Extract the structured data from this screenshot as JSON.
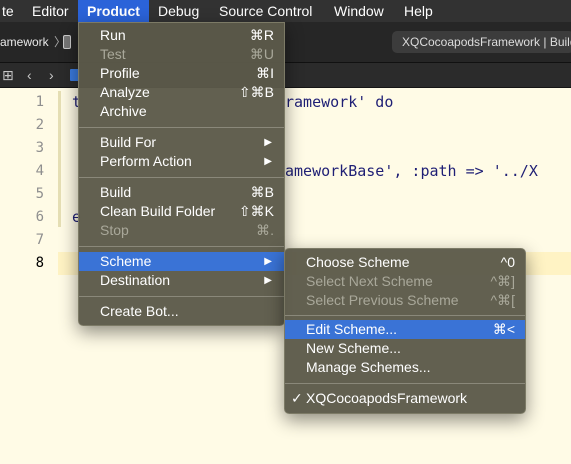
{
  "menubar": {
    "items": [
      {
        "label": "te"
      },
      {
        "label": "Editor"
      },
      {
        "label": "Product"
      },
      {
        "label": "Debug"
      },
      {
        "label": "Source Control"
      },
      {
        "label": "Window"
      },
      {
        "label": "Help"
      }
    ]
  },
  "toolbar": {
    "scheme_crumb": "amework",
    "activity_text": "XQCocoapodsFramework | Build"
  },
  "editor": {
    "line_numbers": [
      "1",
      "2",
      "3",
      "4",
      "5",
      "6",
      "7",
      "8"
    ],
    "lines": [
      {
        "text": "t",
        "tail": "ramework' do"
      },
      {
        "text": "",
        "tail": ""
      },
      {
        "text": "",
        "tail": ""
      },
      {
        "text": "",
        "tail": "ameworkBase', :path => '../X"
      },
      {
        "text": "",
        "tail": ""
      },
      {
        "text": "e",
        "tail": ""
      },
      {
        "text": "",
        "tail": ""
      },
      {
        "text": "",
        "tail": ""
      }
    ]
  },
  "product_menu": {
    "items": [
      {
        "label": "Run",
        "shortcut": "⌘R"
      },
      {
        "label": "Test",
        "shortcut": "⌘U",
        "disabled": true
      },
      {
        "label": "Profile",
        "shortcut": "⌘I"
      },
      {
        "label": "Analyze",
        "shortcut": "⇧⌘B"
      },
      {
        "label": "Archive",
        "shortcut": ""
      },
      {
        "label": "Build For",
        "submenu": "▶"
      },
      {
        "label": "Perform Action",
        "submenu": "▶"
      },
      {
        "label": "Build",
        "shortcut": "⌘B"
      },
      {
        "label": "Clean Build Folder",
        "shortcut": "⇧⌘K"
      },
      {
        "label": "Stop",
        "shortcut": "⌘.",
        "disabled": true
      },
      {
        "label": "Scheme",
        "submenu": "▶"
      },
      {
        "label": "Destination",
        "submenu": "▶"
      },
      {
        "label": "Create Bot..."
      }
    ]
  },
  "scheme_menu": {
    "items": [
      {
        "label": "Choose Scheme",
        "shortcut": "^0"
      },
      {
        "label": "Select Next Scheme",
        "shortcut": "^⌘]",
        "disabled": true
      },
      {
        "label": "Select Previous Scheme",
        "shortcut": "^⌘[",
        "disabled": true
      },
      {
        "label": "Edit Scheme...",
        "shortcut": "⌘<"
      },
      {
        "label": "New Scheme..."
      },
      {
        "label": "Manage Schemes..."
      },
      {
        "label": "XQCocoapodsFramework",
        "check": "✓"
      }
    ]
  },
  "colors": {
    "menubar_bg": "#323232",
    "active_menu": "#2b63d9",
    "highlight": "#3a73d6",
    "menu_bg": "#5c5a4a",
    "editor_bg": "#fffbe6"
  }
}
